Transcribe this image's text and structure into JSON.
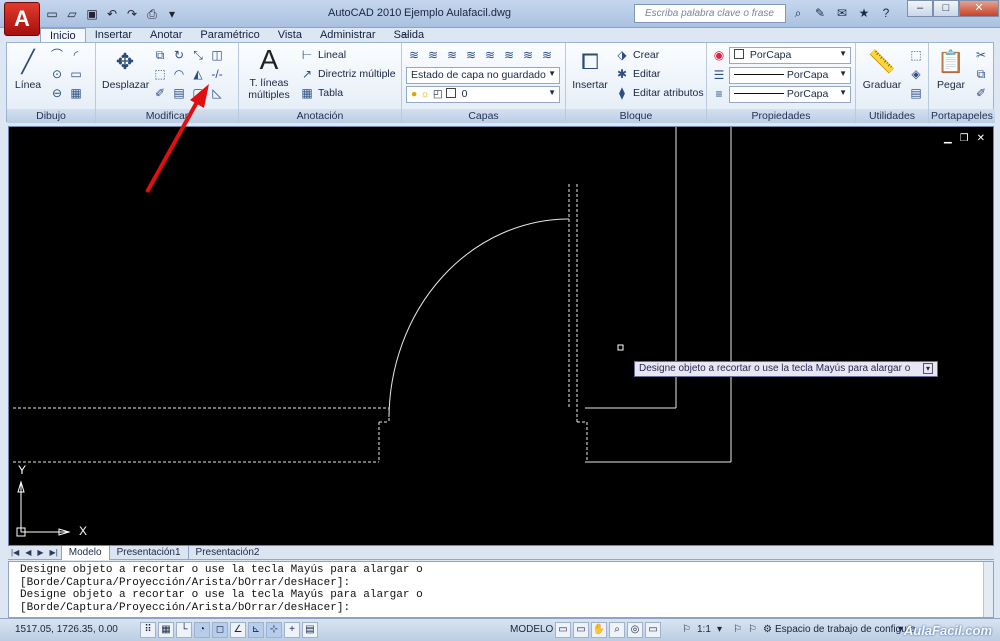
{
  "title": {
    "app": "AutoCAD 2010",
    "file": "Ejemplo Aulafacil.dwg"
  },
  "search": {
    "placeholder": "Escriba palabra clave o frase"
  },
  "tabs": [
    "Inicio",
    "Insertar",
    "Anotar",
    "Paramétrico",
    "Vista",
    "Administrar",
    "Salida"
  ],
  "ribbon": {
    "dibujo": {
      "label": "Dibujo",
      "linea": "Línea"
    },
    "modificar": {
      "label": "Modificar",
      "desplazar": "Desplazar"
    },
    "anotacion": {
      "label": "Anotación",
      "tlineas1": "T. líneas",
      "tlineas2": "múltiples",
      "lineal": "Lineal",
      "directriz": "Directriz múltiple",
      "tabla": "Tabla"
    },
    "capas": {
      "label": "Capas",
      "estado": "Estado de capa no guardado",
      "layer": "0"
    },
    "bloque": {
      "label": "Bloque",
      "insertar": "Insertar",
      "crear": "Crear",
      "editar": "Editar",
      "atributos": "Editar atributos"
    },
    "propiedades": {
      "label": "Propiedades",
      "color": "PorCapa",
      "linetype": "PorCapa",
      "lineweight": "PorCapa"
    },
    "utilidades": {
      "label": "Utilidades",
      "graduar": "Graduar"
    },
    "portapapeles": {
      "label": "Portapapeles",
      "pegar": "Pegar"
    }
  },
  "drawing": {
    "tooltip": "Designe objeto a recortar o use la tecla Mayús para alargar o",
    "ucs_x": "X",
    "ucs_y": "Y"
  },
  "layout_tabs": [
    "Modelo",
    "Presentación1",
    "Presentación2"
  ],
  "command_lines": [
    "Designe objeto a recortar o use la tecla Mayús para alargar o",
    "[Borde/Captura/Proyección/Arista/bOrrar/desHacer]:",
    "Designe objeto a recortar o use la tecla Mayús para alargar o",
    "[Borde/Captura/Proyección/Arista/bOrrar/desHacer]:"
  ],
  "status": {
    "coords": "1517.05, 1726.35, 0.00",
    "modelo": "MODELO",
    "scale": "1:1",
    "workspace": "Espacio de trabajo de configura",
    "brand": "AulaFacil.com"
  }
}
